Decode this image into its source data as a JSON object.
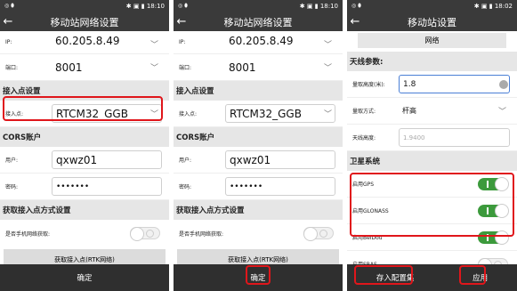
{
  "status": {
    "s1": "18:10",
    "s2": "18:10",
    "s3": "18:02"
  },
  "p1": {
    "title": "移动站网络设置",
    "ip_label": "IP:",
    "ip": "60.205.8.49",
    "port_label": "端口:",
    "port": "8001",
    "sec_access": "接入点设置",
    "ap_label": "接入点:",
    "ap": "RTCM32_GGB",
    "sec_cors": "CORS账户",
    "user_label": "用户:",
    "user": "qxwz01",
    "pw_label": "密码:",
    "pw": "•••••••",
    "sec_method": "获取接入点方式设置",
    "phone_net_label": "是否手机网络获取:",
    "get_btn": "获取接入点(RTK网络)",
    "confirm": "确定"
  },
  "p2": {
    "title": "移动站网络设置",
    "ip_label": "IP:",
    "ip": "60.205.8.49",
    "port_label": "端口:",
    "port": "8001",
    "sec_access": "接入点设置",
    "ap_label": "接入点:",
    "ap": "RTCM32_GGB",
    "sec_cors": "CORS账户",
    "user_label": "用户:",
    "user": "qxwz01",
    "pw_label": "密码:",
    "pw": "•••••••",
    "sec_method": "获取接入点方式设置",
    "phone_net_label": "是否手机网络获取:",
    "get_btn": "获取接入点(RTK网络)",
    "confirm": "确定"
  },
  "p3": {
    "title": "移动站设置",
    "network_btn": "网络",
    "sec_antenna": "天线参数:",
    "height_label": "量取高度(米):",
    "height": "1.8",
    "method_label": "量取方式:",
    "method": "杆高",
    "ant_height_label": "天线高度:",
    "ant_height": "1.9400",
    "sec_sat": "卫星系统",
    "gps": "启用GPS",
    "glonass": "启用GLONASS",
    "beidou": "启用BeiDou",
    "sbas": "启用SBAS",
    "save": "存入配置集",
    "apply": "应用"
  }
}
